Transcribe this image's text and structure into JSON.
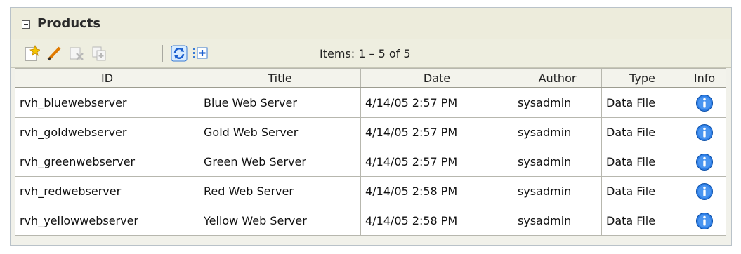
{
  "panel": {
    "title": "Products",
    "items_text": "Items: 1 – 5 of 5"
  },
  "toolbar": {
    "icons": [
      "new-item-icon",
      "edit-pencil-icon",
      "delete-icon",
      "copy-icon",
      "refresh-icon",
      "add-column-icon"
    ]
  },
  "table": {
    "headers": [
      "ID",
      "Title",
      "Date",
      "Author",
      "Type",
      "Info"
    ],
    "rows": [
      [
        "rvh_bluewebserver",
        "Blue Web Server",
        "4/14/05 2:57 PM",
        "sysadmin",
        "Data File"
      ],
      [
        "rvh_goldwebserver",
        "Gold Web Server",
        "4/14/05 2:57 PM",
        "sysadmin",
        "Data File"
      ],
      [
        "rvh_greenwebserver",
        "Green Web Server",
        "4/14/05 2:57 PM",
        "sysadmin",
        "Data File"
      ],
      [
        "rvh_redwebserver",
        "Red Web Server",
        "4/14/05 2:58 PM",
        "sysadmin",
        "Data File"
      ],
      [
        "rvh_yellowwebserver",
        "Yellow Web Server",
        "4/14/05 2:58 PM",
        "sysadmin",
        "Data File"
      ]
    ]
  },
  "colors": {
    "header_bg": "#edecdc",
    "table_border": "#b7b7ae",
    "info_blue": "#1f6fd6"
  }
}
